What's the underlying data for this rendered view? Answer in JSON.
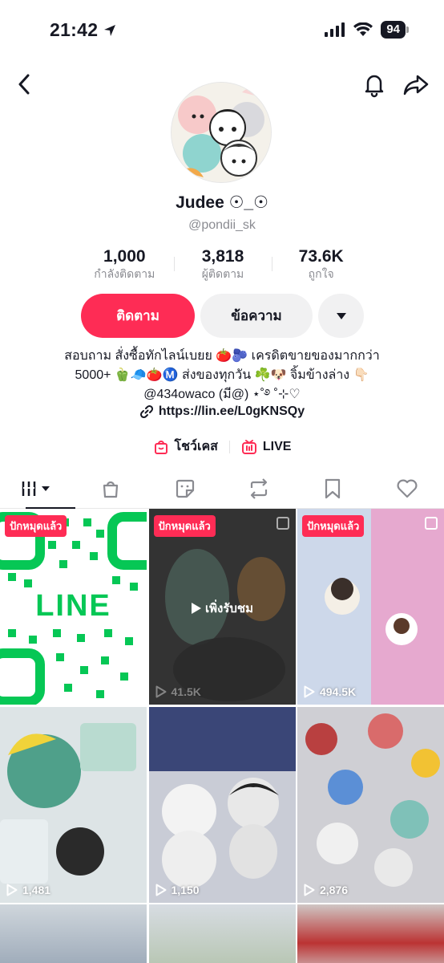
{
  "status": {
    "time": "21:42",
    "battery": "94"
  },
  "profile": {
    "display_name": "Judee ☉_☉",
    "username": "@pondii_sk"
  },
  "stats": [
    {
      "value": "1,000",
      "label": "กำลังติดตาม"
    },
    {
      "value": "3,818",
      "label": "ผู้ติดตาม"
    },
    {
      "value": "73.6K",
      "label": "ถูกใจ"
    }
  ],
  "actions": {
    "follow": "ติดตาม",
    "message": "ข้อความ"
  },
  "bio": {
    "line1": "สอบถาม สั่งซื้อทักไลน์เบยย 🍅🫐 เครดิตขายของมากกว่า",
    "line2": "5000+ 🫑🧢🍅Ⓜ️ ส่งของทุกวัน ☘️🐶 จิ้มข้างล่าง 👇🏻",
    "line3": "@434owaco (มี@) ⋆˚࿔ ˚⊹♡",
    "link": "https://lin.ee/L0gKNSQy"
  },
  "extras": {
    "showcase": "โชว์เคส",
    "live": "LIVE"
  },
  "tabs": [
    "videos",
    "shop",
    "reposts-sticker",
    "repost",
    "saved",
    "liked"
  ],
  "grid": [
    {
      "pinned": "ปักหมุดแล้ว",
      "views": "",
      "label": "LINE"
    },
    {
      "pinned": "ปักหมุดแล้ว",
      "views": "41.5K",
      "watched": "เพิ่งรับชม"
    },
    {
      "pinned": "ปักหมุดแล้ว",
      "views": "494.5K"
    },
    {
      "views": "1,481"
    },
    {
      "views": "1,150"
    },
    {
      "views": "2,876"
    },
    {
      "views": ""
    },
    {
      "views": ""
    },
    {
      "views": ""
    }
  ],
  "colors": {
    "accent": "#fe2c55",
    "text": "#161823",
    "muted": "#8a8b91"
  }
}
